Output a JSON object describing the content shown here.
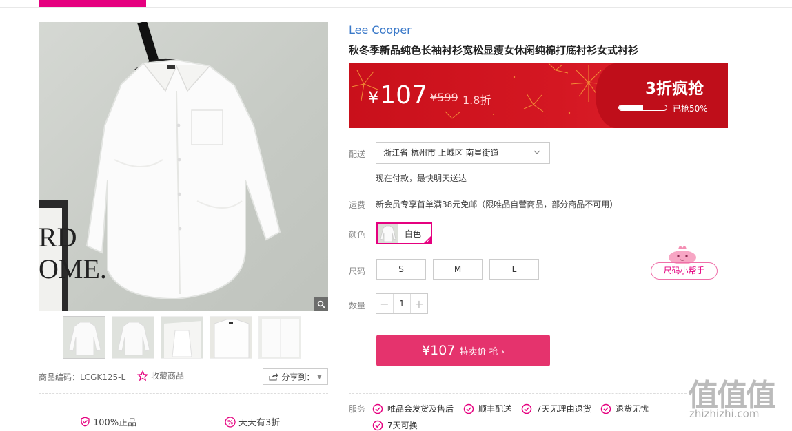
{
  "product": {
    "brand": "Lee Cooper",
    "title": "秋冬季新品纯色长袖衬衫宽松显瘦女休闲纯棉打底衬衫女式衬衫",
    "code_label": "商品编码：LCGK125-L",
    "favorite_label": "收藏商品",
    "share_label": "分享到：",
    "thumbnails": [
      "thumb-1",
      "thumb-2",
      "thumb-3",
      "thumb-4",
      "thumb-5"
    ],
    "frame_text": "RD\nOME."
  },
  "banner": {
    "currency": "¥",
    "price": "107",
    "original_price": "¥599",
    "discount": "1.8折",
    "flash_label": "3折疯抢",
    "sold_label": "已抢50%",
    "sold_fraction": 0.5
  },
  "delivery": {
    "label": "配送",
    "address": "浙江省 杭州市 上城区 南星街道",
    "eta": "现在付款，最快明天送达"
  },
  "shipping": {
    "label": "运费",
    "text": "新会员专享首单满38元免邮（限唯品自营商品，部分商品不可用）"
  },
  "color": {
    "label": "颜色",
    "options": [
      "白色"
    ]
  },
  "size": {
    "label": "尺码",
    "options": [
      "S",
      "M",
      "L"
    ],
    "helper": "尺码小帮手"
  },
  "quantity": {
    "label": "数量",
    "value": "1",
    "minus": "−",
    "plus": "+"
  },
  "buy": {
    "price": "¥107",
    "label": "特卖价 抢 ›"
  },
  "service": {
    "label": "服务",
    "items": [
      "唯品会发货及售后",
      "顺丰配送",
      "7天无理由退货",
      "退货无忧",
      "7天可换"
    ]
  },
  "guarantees": [
    "100%正品",
    "天天有3折"
  ],
  "watermark": {
    "glyphs": "值值值",
    "url": "zhizhizhi.com"
  },
  "colors": {
    "accent": "#e5007f",
    "brand_blue": "#3a79c9",
    "banner_red": "#d41722",
    "buy": "#e5336d"
  }
}
